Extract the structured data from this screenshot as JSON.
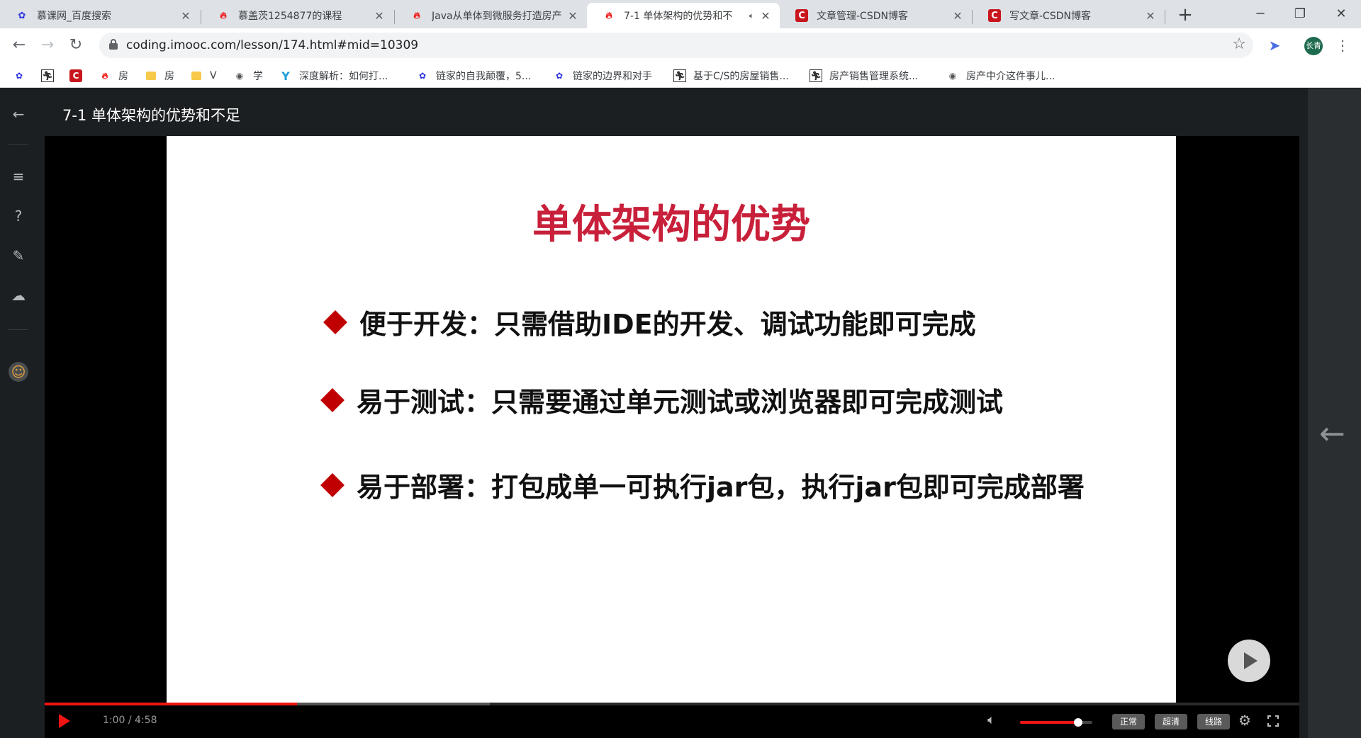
{
  "browser": {
    "tabs": [
      {
        "title": "慕课网_百度搜索",
        "favicon": "baidu-paw-icon",
        "active": false
      },
      {
        "title": "慕盖茨1254877的课程",
        "favicon": "imooc-flame-icon",
        "active": false
      },
      {
        "title": "Java从单体到微服务打造房产",
        "favicon": "imooc-flame-icon",
        "active": false
      },
      {
        "title": "7-1 单体架构的优势和不",
        "favicon": "imooc-flame-icon",
        "active": true,
        "audio": true
      },
      {
        "title": "文章管理-CSDN博客",
        "favicon": "csdn-c-icon",
        "active": false
      },
      {
        "title": "写文章-CSDN博客",
        "favicon": "csdn-c-icon",
        "active": false
      }
    ],
    "url": "coding.imooc.com/lesson/174.html#mid=10309",
    "profile_initials": "长青",
    "bookmarks": [
      {
        "label": "",
        "icon": "baidu-paw-icon"
      },
      {
        "label": "",
        "icon": "runner-icon"
      },
      {
        "label": "",
        "icon": "csdn-c-icon"
      },
      {
        "label": "房",
        "icon": "imooc-flame-icon"
      },
      {
        "label": "房",
        "icon": "folder-icon"
      },
      {
        "label": "V",
        "icon": "folder-icon"
      },
      {
        "label": "学",
        "icon": "globe-icon"
      },
      {
        "label": "深度解析：如何打...",
        "icon": "y-icon"
      },
      {
        "label": "链家的自我颠覆，5...",
        "icon": "baidu-paw-icon"
      },
      {
        "label": "链家的边界和对手",
        "icon": "baidu-paw-icon"
      },
      {
        "label": "基于C/S的房屋销售...",
        "icon": "runner-icon"
      },
      {
        "label": "房产销售管理系统...",
        "icon": "runner-icon"
      },
      {
        "label": "房产中介这件事儿...",
        "icon": "globe-icon"
      }
    ]
  },
  "lesson": {
    "title": "7-1 单体架构的优势和不足"
  },
  "slide": {
    "title": "单体架构的优势",
    "bullets": [
      "便于开发：只需借助IDE的开发、调试功能即可完成",
      "易于测试：只需要通过单元测试或浏览器即可完成测试",
      "易于部署：打包成单一可执行jar包，执行jar包即可完成部署"
    ]
  },
  "player": {
    "time": "1:00 / 4:58",
    "progress_fraction": 0.2013,
    "buffer_fraction": 0.355,
    "volume_fraction": 0.8,
    "quality_buttons": [
      "正常",
      "超清",
      "线路"
    ]
  },
  "colors": {
    "slide_title": "#c8203a",
    "bullet_diamond": "#c00000",
    "progress": "#f01414"
  }
}
